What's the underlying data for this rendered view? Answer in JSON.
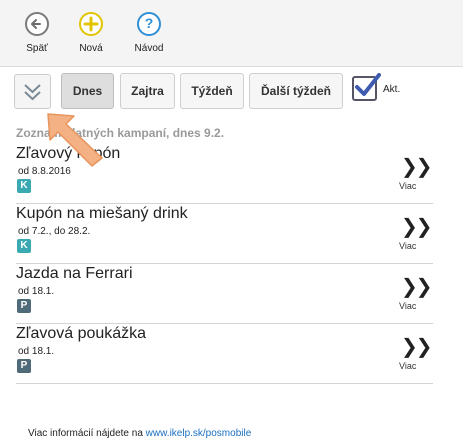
{
  "toolbar": {
    "back_label": "Späť",
    "new_label": "Nová",
    "help_label": "Návod",
    "help_glyph": "?",
    "new_glyph": "+"
  },
  "filters": {
    "days": [
      "Dnes",
      "Zajtra",
      "Týždeň",
      "Ďalší týždeň"
    ],
    "active": "Dnes",
    "checkbox_label": "Akt.",
    "checkbox_checked": true
  },
  "list": {
    "title": "Zoznam platných kampaní, dnes 9.2.",
    "more_label": "Viac",
    "items": [
      {
        "name": "Zľavový kupón",
        "date": "od 8.8.2016",
        "badge": "K",
        "badge_color": "#3aa9b2"
      },
      {
        "name": "Kupón na miešaný drink",
        "date": "od 7.2., do 28.2.",
        "badge": "K",
        "badge_color": "#3aa9b2"
      },
      {
        "name": "Jazda na Ferrari",
        "date": "od 18.1.",
        "badge": "P",
        "badge_color": "#4f6a78"
      },
      {
        "name": "Zľavová poukážka",
        "date": "od 18.1.",
        "badge": "P",
        "badge_color": "#4f6a78"
      }
    ]
  },
  "footer": {
    "text": "Viac informácií nájdete na ",
    "link": "www.ikelp.sk/posmobile"
  },
  "colors": {
    "accent_link": "#1a6fc2",
    "pointer_arrow": "#f4b183"
  }
}
